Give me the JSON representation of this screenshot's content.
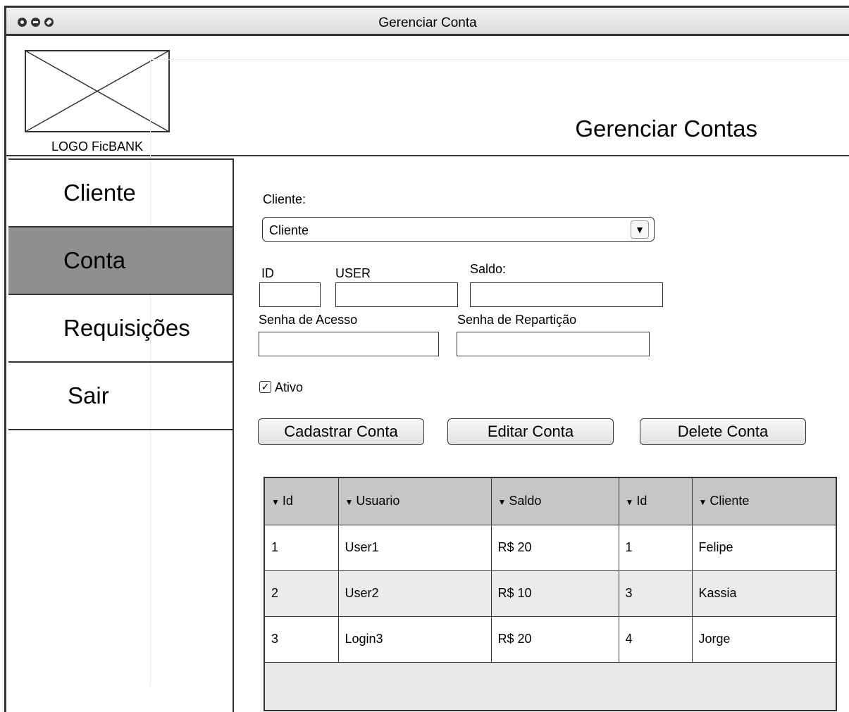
{
  "window": {
    "title": "Gerenciar Conta"
  },
  "header": {
    "logo_label": "LOGO FicBANK",
    "page_title": "Gerenciar Contas"
  },
  "sidebar": {
    "items": [
      {
        "label": "Cliente",
        "active": false
      },
      {
        "label": "Conta",
        "active": true
      },
      {
        "label": "Requisições",
        "active": false
      },
      {
        "label": "Sair",
        "active": false
      }
    ]
  },
  "form": {
    "cliente_label": "Cliente:",
    "cliente_selected": "Cliente",
    "id_label": "ID",
    "user_label": "USER",
    "saldo_label": "Saldo:",
    "senha_acesso_label": "Senha de Acesso",
    "senha_reparticao_label": "Senha de Repartição",
    "id_value": "",
    "user_value": "",
    "saldo_value": "",
    "senha_acesso_value": "",
    "senha_reparticao_value": "",
    "ativo_label": "Ativo",
    "ativo_checked": true
  },
  "buttons": {
    "cadastrar": "Cadastrar Conta",
    "editar": "Editar Conta",
    "delete": "Delete Conta"
  },
  "table": {
    "columns": [
      "Id",
      "Usuario",
      "Saldo",
      "Id",
      "Cliente"
    ],
    "rows": [
      [
        "1",
        "User1",
        "R$ 20",
        "1",
        "Felipe"
      ],
      [
        "2",
        "User2",
        "R$ 10",
        "3",
        "Kassia"
      ],
      [
        "3",
        "Login3",
        "R$ 20",
        "4",
        "Jorge"
      ]
    ]
  },
  "icons": {
    "caret": "▼",
    "sort": "▼",
    "check": "✓"
  }
}
